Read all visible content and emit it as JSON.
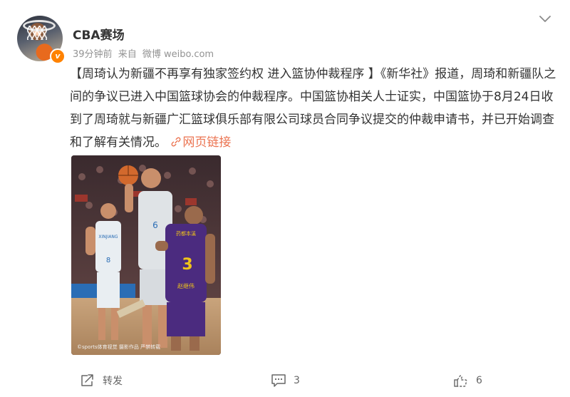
{
  "header": {
    "account_name": "CBA赛场",
    "time": "39分钟前",
    "source_prefix": "来自",
    "source": "微博 weibo.com",
    "verified_badge": "v"
  },
  "post": {
    "text_main": "【周琦认为新疆不再享有独家签约权 进入篮协仲裁程序 】《新华社》报道，周琦和新疆队之间的争议已进入中国篮球协会的仲裁程序。中国篮协相关人士证实，中国篮协于8月24日收到了周琦就与新疆广汇篮球俱乐部有限公司球员合同争议提交的仲裁申请书，并已开始调查和了解有关情况。",
    "link_label": "网页链接"
  },
  "photo": {
    "jersey_number_front": "3",
    "jersey_name_front": "赵继伟",
    "jersey_sponsor_front": "药都本溪",
    "jersey_number_back": "6",
    "jersey_text_left": "XINJIANG",
    "jersey_number_left": "8",
    "watermark": "©sports体育视觉 摄影作品 严禁转载"
  },
  "actions": {
    "repost_label": "转发",
    "comment_count": "3",
    "like_count": "6"
  },
  "colors": {
    "link": "#eb7350",
    "verified": "#ff8200",
    "meta_text": "#939393"
  },
  "icons": [
    "chevron-down-icon",
    "link-icon",
    "repost-icon",
    "comment-icon",
    "like-icon"
  ]
}
